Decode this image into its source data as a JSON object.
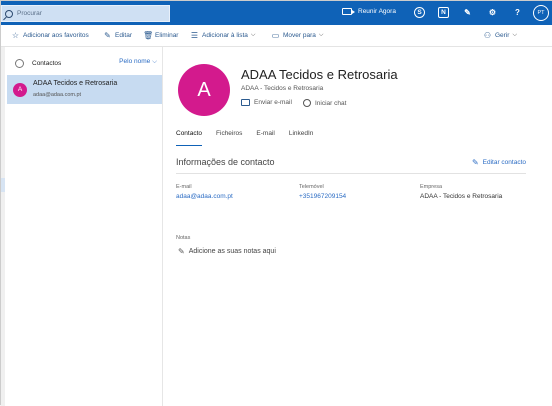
{
  "topbar": {
    "search_placeholder": "Procurar",
    "meet_now": "Reunir Agora",
    "icons": [
      "video-icon",
      "skype-icon",
      "onenote-icon",
      "feedback-icon",
      "settings-icon",
      "help-icon"
    ],
    "user_initials": "PT",
    "color": "#0f62b7"
  },
  "toolbar": {
    "add_favorites": "Adicionar aos favoritos",
    "edit": "Editar",
    "delete": "Eliminar",
    "add_to_list": "Adicionar à lista",
    "move_to": "Mover para",
    "manage": "Gerir"
  },
  "list": {
    "title": "Contactos",
    "sort": "Pelo nome",
    "items": [
      {
        "initial": "A",
        "name": "ADAA Tecidos e Retrosaria",
        "email": "adaa@adaa.com.pt"
      }
    ]
  },
  "contact": {
    "initial": "A",
    "name": "ADAA Tecidos e Retrosaria",
    "subtitle": "ADAA - Tecidos e Retrosaria",
    "send_email": "Enviar e-mail",
    "start_chat": "Iniciar chat",
    "avatar_color": "#d31a8d"
  },
  "tabs": [
    "Contacto",
    "Ficheiros",
    "E-mail",
    "LinkedIn"
  ],
  "info": {
    "title": "Informações de contacto",
    "edit": "Editar contacto",
    "email_label": "E-mail",
    "email_value": "adaa@adaa.com.pt",
    "phone_label": "Telemóvel",
    "phone_value": "+351967209154",
    "company_label": "Empresa",
    "company_value": "ADAA - Tecidos e Retrosaria"
  },
  "notes": {
    "label": "Notas",
    "add": "Adicione as suas notas aqui"
  }
}
